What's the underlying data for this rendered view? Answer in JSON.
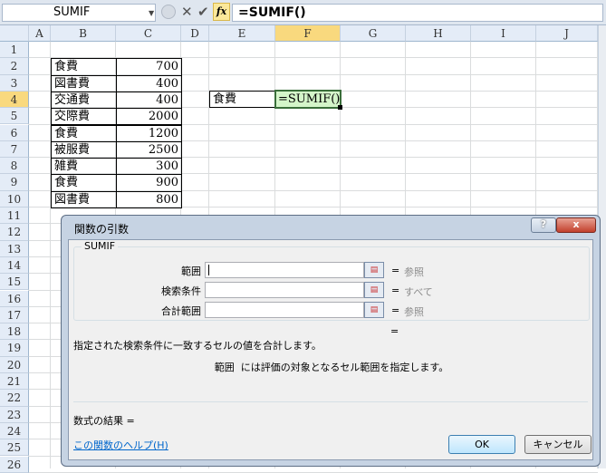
{
  "formula_bar": {
    "name_box": "SUMIF",
    "formula": "=SUMIF()",
    "fx_label": "fx"
  },
  "columns": [
    "A",
    "B",
    "C",
    "D",
    "E",
    "F",
    "G",
    "H",
    "I",
    "J"
  ],
  "rows": [
    "1",
    "2",
    "3",
    "4",
    "5",
    "6",
    "7",
    "8",
    "9",
    "10",
    "11",
    "12",
    "13",
    "14",
    "15",
    "16",
    "17",
    "18",
    "19",
    "20",
    "21",
    "22",
    "23",
    "24",
    "25",
    "26"
  ],
  "table": [
    {
      "item": "食費",
      "amount": "700"
    },
    {
      "item": "図書費",
      "amount": "400"
    },
    {
      "item": "交通費",
      "amount": "400"
    },
    {
      "item": "交際費",
      "amount": "2000"
    },
    {
      "item": "食費",
      "amount": "1200"
    },
    {
      "item": "被服費",
      "amount": "2500"
    },
    {
      "item": "雑費",
      "amount": "300"
    },
    {
      "item": "食費",
      "amount": "900"
    },
    {
      "item": "図書費",
      "amount": "800"
    }
  ],
  "criteria_cell": {
    "E4": "食費",
    "F4": "=SUMIF()"
  },
  "dialog": {
    "title": "関数の引数",
    "help_icon": "?",
    "close_icon": "x",
    "function_name": "SUMIF",
    "args": [
      {
        "label": "範囲",
        "value": "",
        "result": "参照"
      },
      {
        "label": "検索条件",
        "value": "",
        "result": "すべて"
      },
      {
        "label": "合計範囲",
        "value": "",
        "result": "参照"
      }
    ],
    "equals": "=",
    "description": "指定された検索条件に一致するセルの値を合計します。",
    "arg_description_name": "範囲",
    "arg_description": "には評価の対象となるセル範囲を指定します。",
    "formula_result_label": "数式の結果 =",
    "help_link": "この関数のヘルプ(H)",
    "ok": "OK",
    "cancel": "キャンセル"
  }
}
